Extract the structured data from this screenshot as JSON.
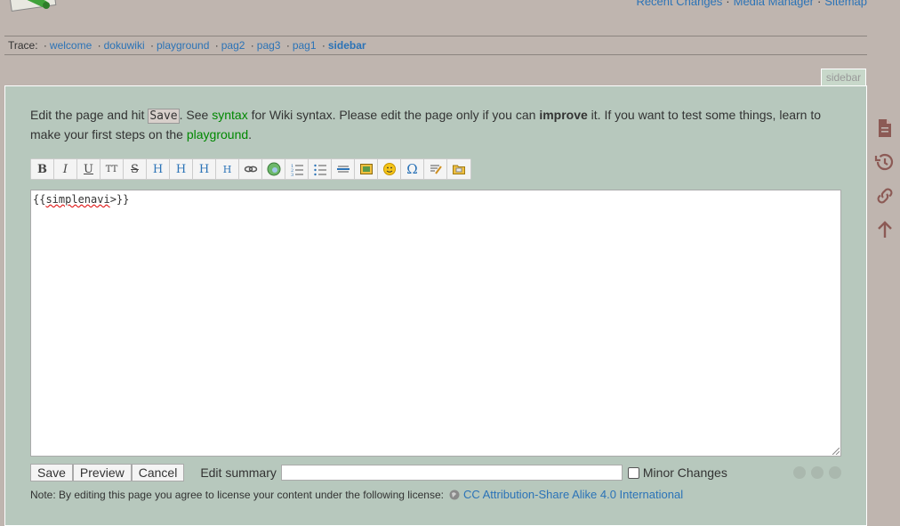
{
  "header": {
    "top_links": [
      "Recent Changes",
      "Media Manager",
      "Sitemap"
    ],
    "logo_icon": "dokuwiki-logo-icon"
  },
  "trace": {
    "label": "Trace:",
    "items": [
      "welcome",
      "dokuwiki",
      "playground",
      "pag2",
      "pag3",
      "pag1"
    ],
    "current": "sidebar"
  },
  "page_id_tab": "sidebar",
  "intro": {
    "part1": "Edit the page and hit ",
    "save_code": "Save",
    "part2": ". See ",
    "syntax_link": "syntax",
    "part3": " for Wiki syntax. Please edit the page only if you can ",
    "improve": "improve",
    "part4": " it. If you want to test some things, learn to make your first steps on the ",
    "playground_link": "playground",
    "part5": "."
  },
  "toolbar": {
    "buttons": [
      {
        "name": "bold-button",
        "label": "B"
      },
      {
        "name": "italic-button",
        "label": "I"
      },
      {
        "name": "underline-button",
        "label": "U"
      },
      {
        "name": "monospace-button",
        "label": "TT"
      },
      {
        "name": "strikethrough-button",
        "label": "S"
      },
      {
        "name": "heading-same-level-button",
        "label": "H"
      },
      {
        "name": "heading-lower-button",
        "label": "H"
      },
      {
        "name": "heading-higher-button",
        "label": "H"
      },
      {
        "name": "heading-select-button",
        "label": "H"
      },
      {
        "name": "internal-link-button",
        "label": "link-icon"
      },
      {
        "name": "external-link-button",
        "label": "globe-icon"
      },
      {
        "name": "ordered-list-button",
        "label": "ordered-list-icon"
      },
      {
        "name": "unordered-list-button",
        "label": "unordered-list-icon"
      },
      {
        "name": "horizontal-rule-button",
        "label": "hr-icon"
      },
      {
        "name": "media-button",
        "label": "image-icon"
      },
      {
        "name": "smileys-button",
        "label": "smiley-icon"
      },
      {
        "name": "special-chars-button",
        "label": "Ω"
      },
      {
        "name": "signature-button",
        "label": "signature-icon"
      },
      {
        "name": "plugin-button",
        "label": "folder-icon"
      }
    ]
  },
  "editor": {
    "prefix": "{{",
    "word": "simplenavi",
    "suffix": ">}}"
  },
  "bottom": {
    "save": "Save",
    "preview": "Preview",
    "cancel": "Cancel",
    "summary_label": "Edit summary",
    "summary_value": "",
    "minor_label": "Minor Changes"
  },
  "license": {
    "text": "Note: By editing this page you agree to license your content under the following license:",
    "link": "CC Attribution-Share Alike 4.0 International"
  },
  "colors": {
    "background": "#bfb5af",
    "page": "#b7c8bd",
    "link": "#2b73b7",
    "wiki_link": "#008800",
    "tools": "#8c5a55"
  }
}
